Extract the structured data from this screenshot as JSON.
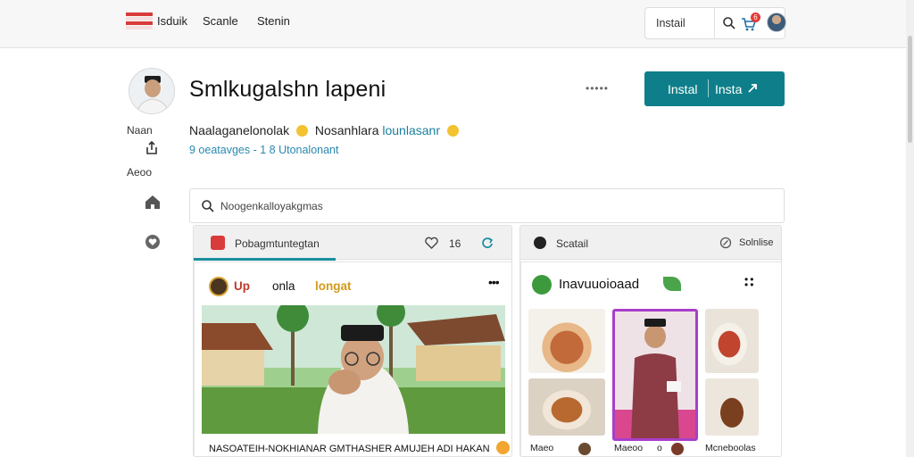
{
  "topbar": {
    "nav": [
      "Isduik",
      "Scanle",
      "Stenin"
    ],
    "install_label": "Instail",
    "cart_badge": "6"
  },
  "profile": {
    "title": "Smlkugalshn lapeni",
    "more": "•••••",
    "install_a": "Instal",
    "install_b": "Insta",
    "side_label_1": "Naan",
    "side_label_2": "Aeoo",
    "bio_main": "Naalaganelonolak",
    "bio_mid": "Nosanhlara",
    "bio_hl": "lounlasanr",
    "subtext": "9 oeatavges - 1 8 Utonalonant"
  },
  "search": {
    "placeholder": "Noogenkalloyakgmas"
  },
  "left_panel": {
    "tab_label": "Pobagmtuntegtan",
    "tab_count": "16",
    "card_title_a": "Up",
    "card_title_b": "onla",
    "card_title_c": "longat",
    "caption": "NASOATEIH-NOKHIANAR  GMTHASHER  AMUJEH  ADI HAKAN"
  },
  "right_panel": {
    "tab_label": "Scatail",
    "tab_right": "Solnlise",
    "card_title": "Inavuuoioaad",
    "thumb_captions": [
      "Maeo",
      "Maeoo",
      "Mcneboolas"
    ],
    "thumb_meta": [
      "o"
    ]
  },
  "colors": {
    "accent": "#0e7f8a",
    "link": "#2a89b0",
    "flag_red": "#d93a3a"
  }
}
